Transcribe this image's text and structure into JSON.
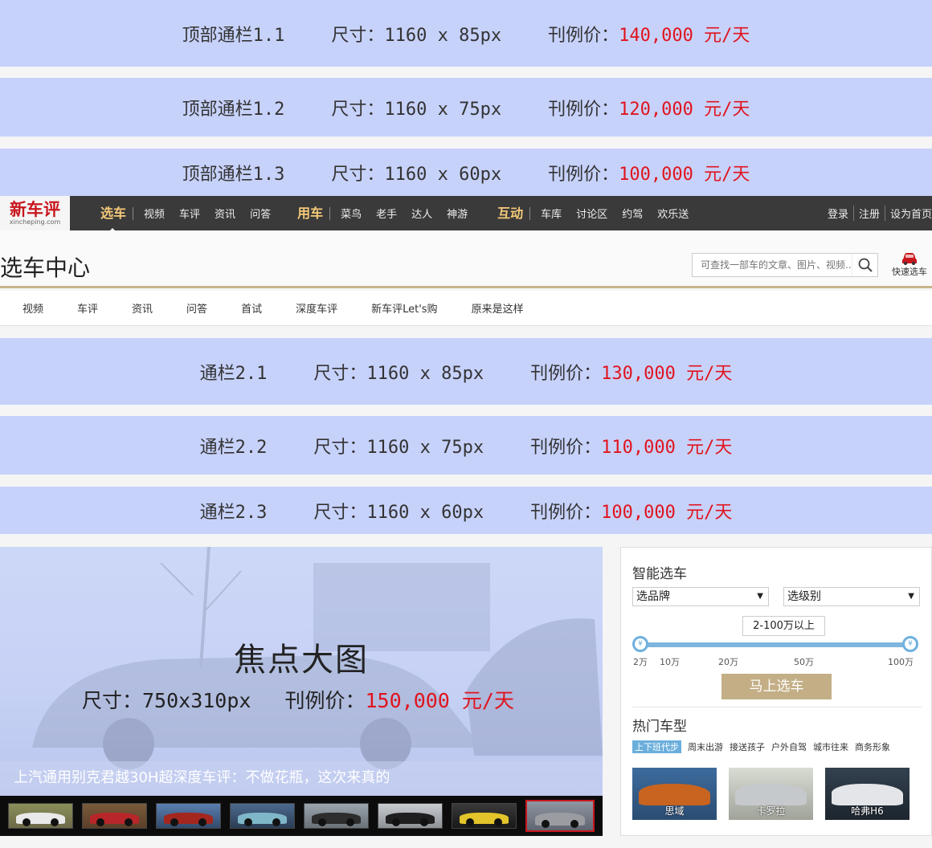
{
  "top_ads": [
    {
      "name": "顶部通栏1.1",
      "size": "尺寸：1160 x 85px",
      "price_label": "刊例价：",
      "price": "140,000 元/天"
    },
    {
      "name": "顶部通栏1.2",
      "size": "尺寸：1160 x 75px",
      "price_label": "刊例价：",
      "price": "120,000 元/天"
    },
    {
      "name": "顶部通栏1.3",
      "size": "尺寸：1160 x 60px",
      "price_label": "刊例价：",
      "price": "100,000 元/天"
    }
  ],
  "logo": {
    "main": "新车评",
    "sub": "xincheping.com"
  },
  "nav": {
    "groups": [
      {
        "title": "选车",
        "items": [
          "视频",
          "车评",
          "资讯",
          "问答"
        ]
      },
      {
        "title": "用车",
        "items": [
          "菜鸟",
          "老手",
          "达人",
          "神游"
        ]
      },
      {
        "title": "互动",
        "items": [
          "车库",
          "讨论区",
          "约驾",
          "欢乐送"
        ]
      }
    ],
    "right": [
      "登录",
      "注册",
      "设为首页"
    ]
  },
  "header": {
    "title": "选车中心",
    "search_placeholder": "可查找一部车的文章、图片、视频...",
    "quick_label": "快速选车"
  },
  "subnav": [
    "视频",
    "车评",
    "资讯",
    "问答",
    "首试",
    "深度车评",
    "新车评Let's购",
    "原来是这样"
  ],
  "mid_ads": [
    {
      "name": "通栏2.1",
      "size": "尺寸：1160 x 85px",
      "price_label": "刊例价：",
      "price": "130,000 元/天"
    },
    {
      "name": "通栏2.2",
      "size": "尺寸：1160 x 75px",
      "price_label": "刊例价：",
      "price": "110,000 元/天"
    },
    {
      "name": "通栏2.3",
      "size": "尺寸：1160 x 60px",
      "price_label": "刊例价：",
      "price": "100,000 元/天"
    }
  ],
  "focus": {
    "title": "焦点大图",
    "size": "尺寸：750x310px",
    "price_label": "刊例价：",
    "price": "150,000 元/天",
    "caption": "上汽通用别克君越30H超深度车评：不做花瓶，这次来真的"
  },
  "panel": {
    "title": "智能选车",
    "brand_select": "选品牌",
    "level_select": "选级别",
    "price_range": "2-100万以上",
    "ticks": [
      "2万",
      "10万",
      "20万",
      "50万",
      "100万"
    ],
    "go_button": "马上选车",
    "hot_title": "热门车型",
    "tags": [
      "上下班代步",
      "周末出游",
      "接送孩子",
      "户外自驾",
      "城市往来",
      "商务形象"
    ],
    "models": [
      "思域",
      "卡罗拉",
      "哈弗H6"
    ]
  },
  "colors": {
    "accent_red": "#e0141e",
    "ad_blue": "#c7d2fb",
    "nav_dark": "#3a3a3a",
    "gold": "#c3ae86"
  }
}
